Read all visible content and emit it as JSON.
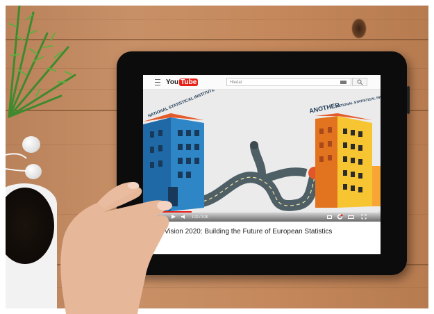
{
  "youtube": {
    "logo_you": "You",
    "logo_tube": "Tube",
    "search_value": "Hledat"
  },
  "video": {
    "title": "ESS Vision 2020: Building the Future of European Statistics",
    "left_building_sign": "NATIONAL STATISTICAL INSTITUTE",
    "right_building_sign_prefix": "ANOTHER",
    "right_building_sign": "NATIONAL STATISTICAL INSTITUTE",
    "time": "1:22 / 3:26",
    "progress_fraction": 0.2
  },
  "colors": {
    "wood": "#c48a5d",
    "left_building": "#2e86c6",
    "right_building": "#f7a635",
    "road": "#4f5f66",
    "youtube_red": "#e62117"
  },
  "icons": [
    "menu-icon",
    "keyboard-icon",
    "search-icon",
    "play-icon",
    "volume-icon",
    "subtitles-icon",
    "settings-icon",
    "theater-icon",
    "fullscreen-icon"
  ]
}
